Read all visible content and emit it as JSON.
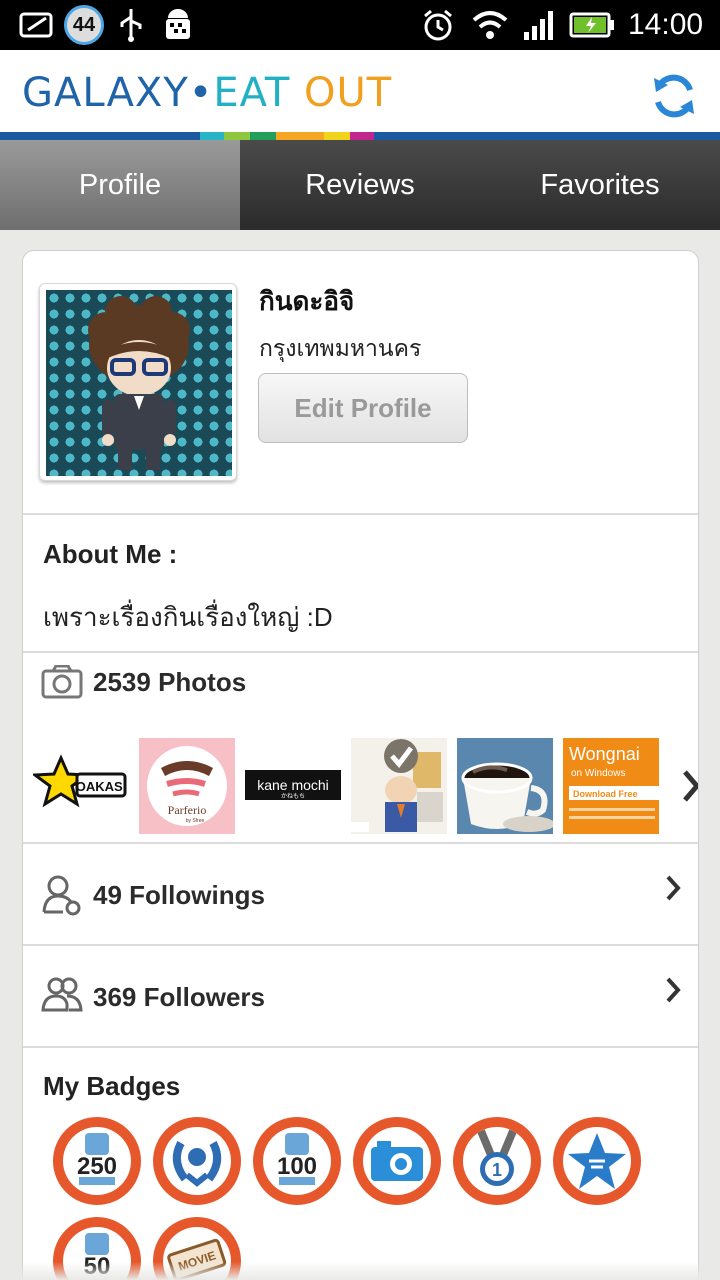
{
  "status_bar": {
    "notification_count": "44",
    "time": "14:00",
    "icons": [
      "message-icon",
      "usb-icon",
      "android-debug-icon",
      "alarm-icon",
      "wifi-icon",
      "signal-icon",
      "battery-charging-icon"
    ]
  },
  "app": {
    "logo_part1": "GALAXY",
    "logo_dot": "•",
    "logo_part2": "EAT ",
    "logo_part3": "OUT",
    "refresh_icon": "refresh-icon",
    "colors": {
      "brand_blue": "#1b5aa0",
      "accent_orange": "#e6582c"
    }
  },
  "tabs": [
    {
      "label": "Profile",
      "active": true
    },
    {
      "label": "Reviews",
      "active": false
    },
    {
      "label": "Favorites",
      "active": false
    }
  ],
  "profile": {
    "name": "กินดะอิจิ",
    "location": "กรุงเทพมหานคร",
    "edit_label": "Edit Profile",
    "about_title": "About Me :",
    "about_text": "เพราะเรื่องกินเรื่องใหญ่ :D",
    "photos_count": "2539",
    "photos_label": "Photos",
    "followings_count": "49",
    "followings_label": "Followings",
    "followers_count": "369",
    "followers_label": "Followers",
    "badges_title": "My Badges"
  },
  "thumbnails": [
    {
      "label": "OAKASI",
      "kind": "oakasi"
    },
    {
      "label": "Parferio",
      "sub": "by Sfree",
      "kind": "parferio"
    },
    {
      "label": "kane mochi",
      "sub": "かねもち",
      "kind": "kanemochi"
    },
    {
      "label": "",
      "kind": "checkbadge"
    },
    {
      "label": "",
      "kind": "coffee"
    },
    {
      "label": "Wongnai",
      "sub": "on Windows",
      "cta": "Download Free",
      "kind": "wongnai"
    }
  ],
  "badges": [
    {
      "number": "250",
      "icon": "trophy-250-icon"
    },
    {
      "number": "",
      "icon": "laurel-icon"
    },
    {
      "number": "100",
      "icon": "trophy-100-icon"
    },
    {
      "number": "",
      "icon": "camera-badge-icon"
    },
    {
      "number": "",
      "icon": "medal-1-icon"
    },
    {
      "number": "",
      "icon": "star-badge-icon"
    },
    {
      "number": "50",
      "icon": "trophy-50-icon"
    },
    {
      "number": "MOVIE",
      "icon": "movie-ticket-icon"
    }
  ]
}
